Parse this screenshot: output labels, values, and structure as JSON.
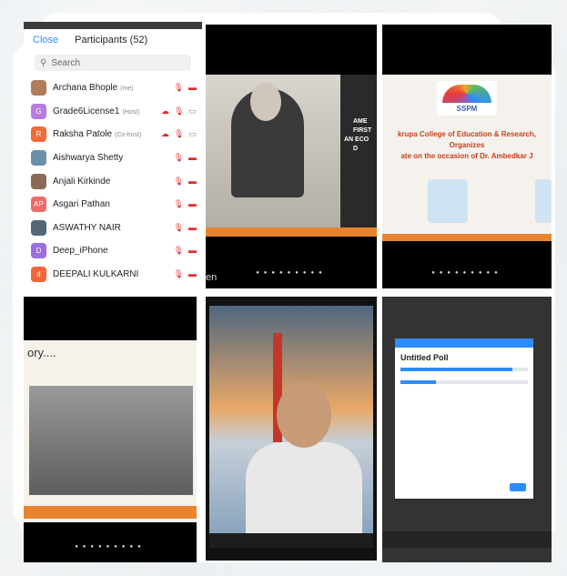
{
  "participants_panel": {
    "close_label": "Close",
    "title": "Participants (52)",
    "search_placeholder": "Search",
    "rows": [
      {
        "name": "Archana Bhople",
        "tag": "(me)",
        "avatar_text": "",
        "avatar_color": "#b07c5a"
      },
      {
        "name": "Grade6License1",
        "tag": "(Host)",
        "avatar_text": "G",
        "avatar_color": "#b97be0"
      },
      {
        "name": "Raksha Patole",
        "tag": "(Co-host)",
        "avatar_text": "R",
        "avatar_color": "#f26a3a"
      },
      {
        "name": "Aishwarya Shetty",
        "tag": "",
        "avatar_text": "",
        "avatar_color": "#6a8fa8"
      },
      {
        "name": "Anjali Kirkinde",
        "tag": "",
        "avatar_text": "",
        "avatar_color": "#8a6a55"
      },
      {
        "name": "Asgari Pathan",
        "tag": "",
        "avatar_text": "AP",
        "avatar_color": "#f16a6a"
      },
      {
        "name": "ASWATHY NAIR",
        "tag": "",
        "avatar_text": "",
        "avatar_color": "#556677"
      },
      {
        "name": "Deep_iPhone",
        "tag": "",
        "avatar_text": "D",
        "avatar_color": "#9a6de0"
      },
      {
        "name": "DEEPALI KULKARNI",
        "tag": "",
        "avatar_text": "d",
        "avatar_color": "#f2643a"
      }
    ]
  },
  "tile_ambedkar": {
    "text_lines": [
      "AME",
      "FIRST",
      "AN ECO",
      "D"
    ],
    "caption": "en"
  },
  "tile_college": {
    "logo_text": "SSPM",
    "line1": "krupa College of Education & Research,",
    "line2": "Organizes",
    "line3": "ate on the occasion of Dr. Ambedkar J"
  },
  "tile_history": {
    "heading": "ory...."
  },
  "poll": {
    "title": "Untitled Poll"
  },
  "colors": {
    "accent": "#2d8cff",
    "slide_orange": "#e8842f",
    "mute_red": "#e02b2b"
  }
}
